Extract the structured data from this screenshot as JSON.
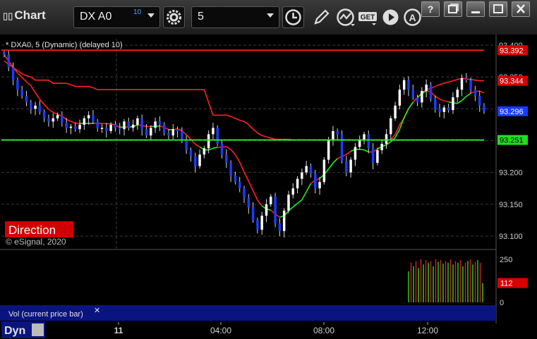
{
  "toolbar": {
    "title": "Chart",
    "symbol": "DX A0",
    "symbol_superscript": "10",
    "interval": "5"
  },
  "chart": {
    "label": "* DXA0, 5 (Dynamic) (delayed 10)",
    "watermark": "© eSignal, 2020",
    "direction_label": "Direction",
    "volume_pane_label": "Vol (current price bar)",
    "volume_close_glyph": "✕",
    "dyn_label": "Dyn",
    "markers": {
      "red_line": "93.392",
      "red_ma": "93.344",
      "last_price": "93.296",
      "green_line": "93.251",
      "volume": "112"
    },
    "colors": {
      "background": "#000000",
      "up_candle": "#ffffff",
      "down_candle": "#1a3cff",
      "ma_red": "#ff2020",
      "ma_green": "#22ee22",
      "grid": "#3a3a3a",
      "volume_pane_bar": "#0a1480"
    }
  },
  "chart_data": {
    "type": "line",
    "price_axis": {
      "ticks": [
        "93.400",
        "93.350",
        "93.300",
        "93.250",
        "93.200",
        "93.150",
        "93.100"
      ],
      "ylim": [
        93.08,
        93.41
      ]
    },
    "volume_axis": {
      "ticks": [
        "250",
        "100",
        "0"
      ]
    },
    "time_axis": {
      "ticks": [
        "11",
        "04:00",
        "08:00",
        "12:00"
      ]
    },
    "grid": true,
    "horizontal_lines": [
      {
        "value": 93.392,
        "color": "#ff2020"
      },
      {
        "value": 93.251,
        "color": "#22ee22"
      }
    ],
    "series": [
      {
        "values": [
          93.385,
          93.365,
          93.345,
          93.33,
          93.32,
          93.31,
          93.3,
          93.305,
          93.295,
          93.285,
          93.28,
          93.285,
          93.29,
          93.278,
          93.27,
          93.272,
          93.268,
          93.275,
          93.285,
          93.29,
          93.28,
          93.27,
          93.27,
          93.265,
          93.275,
          93.27,
          93.268,
          93.28,
          93.27,
          93.275,
          93.285,
          93.268,
          93.258,
          93.27,
          93.28,
          93.275,
          93.262,
          93.258,
          93.268,
          93.265,
          93.25,
          93.235,
          93.225,
          93.21,
          93.228,
          93.238,
          93.26,
          93.27,
          93.245,
          93.228,
          93.215,
          93.195,
          93.185,
          93.175,
          93.16,
          93.145,
          93.125,
          93.11,
          93.132,
          93.15,
          93.162,
          93.12,
          93.108,
          93.14,
          93.165,
          93.175,
          93.19,
          93.2,
          93.21,
          93.198,
          93.175,
          93.185,
          93.22,
          93.25,
          93.265,
          93.26,
          93.218,
          93.2,
          93.22,
          93.24,
          93.25,
          93.26,
          93.238,
          93.215,
          93.235,
          93.245,
          93.26,
          93.285,
          93.305,
          93.33,
          93.345,
          93.33,
          93.318,
          93.31,
          93.328,
          93.338,
          93.315,
          93.3,
          93.295,
          93.302,
          93.298,
          93.318,
          93.33,
          93.348,
          93.345,
          93.33,
          93.32,
          93.305,
          93.296
        ]
      }
    ],
    "moving_average_red": [
      93.375,
      93.37,
      93.365,
      93.36,
      93.355,
      93.352,
      93.35,
      93.345,
      93.345,
      93.345,
      93.345,
      93.34,
      93.34,
      93.34,
      93.34,
      93.338,
      93.335,
      93.335,
      93.335,
      93.335,
      93.333,
      93.33,
      93.33,
      93.33,
      93.33,
      93.33,
      93.33,
      93.33,
      93.33,
      93.33,
      93.33,
      93.33,
      93.33,
      93.33,
      93.33,
      93.33,
      93.33,
      93.33,
      93.33,
      93.33,
      93.33,
      93.33,
      93.33,
      93.33,
      93.33,
      93.33,
      93.31,
      93.29,
      93.29,
      93.29,
      93.29,
      93.288,
      93.285,
      93.282,
      93.28,
      93.275,
      93.268,
      93.262,
      93.258,
      93.256,
      93.254,
      93.252,
      93.252,
      93.252,
      93.252,
      93.251,
      93.251,
      93.251,
      93.251,
      93.251,
      93.251,
      93.251,
      93.251,
      93.251,
      93.251,
      93.251,
      93.251,
      93.251,
      93.251,
      93.251,
      93.251,
      93.251,
      93.251,
      93.251,
      93.251,
      93.251,
      93.251,
      93.251,
      93.26,
      93.275,
      93.285,
      93.3,
      93.31,
      93.318,
      93.325,
      93.33,
      93.332,
      93.335,
      93.338,
      93.34,
      93.342,
      93.344,
      93.346,
      93.348,
      93.347,
      93.346,
      93.345,
      93.344,
      93.344
    ],
    "volume_bars": {
      "values": [
        180,
        230,
        210,
        240,
        200,
        250,
        220,
        245,
        230,
        240,
        210,
        250,
        235,
        245,
        225,
        240,
        230,
        250,
        220,
        240,
        230,
        245,
        210,
        230,
        240,
        250,
        220,
        235,
        245,
        230,
        112
      ],
      "up_color": "#22cc22",
      "down_color": "#cc2222"
    }
  }
}
